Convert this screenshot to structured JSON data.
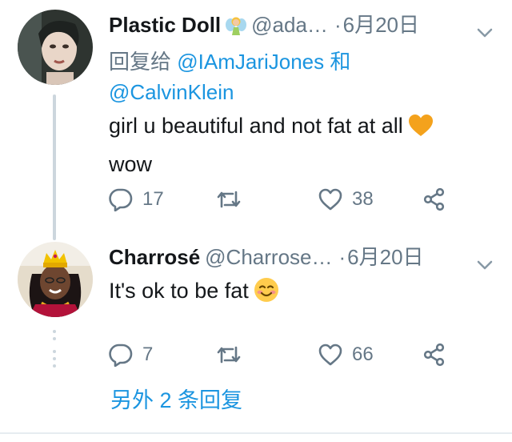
{
  "tweets": [
    {
      "name": "Plastic Doll",
      "name_emoji_icon": "fairy-emoji-icon",
      "handle": "@ada…",
      "separator": "·",
      "date": "6月20日",
      "reply_prefix": "回复给",
      "reply_to_1": "@IAmJariJones",
      "reply_conjunction": "和",
      "reply_to_2": "@CalvinKlein",
      "text": "girl u beautiful and not fat at all",
      "text_emoji_icon": "orange-heart-icon",
      "text_line2": "wow",
      "reply_count": "17",
      "retweet_count": "",
      "like_count": "38"
    },
    {
      "name": "Charrosé",
      "handle": "@Charrose…",
      "separator": "·",
      "date": "6月20日",
      "text": "It's ok to be fat",
      "text_emoji_icon": "smiling-face-icon",
      "reply_count": "7",
      "retweet_count": "",
      "like_count": "66"
    }
  ],
  "more_replies_label": "另外 2 条回复",
  "colors": {
    "link": "#1b95e0",
    "muted": "#657786",
    "thread_line": "#ccd6dd"
  }
}
